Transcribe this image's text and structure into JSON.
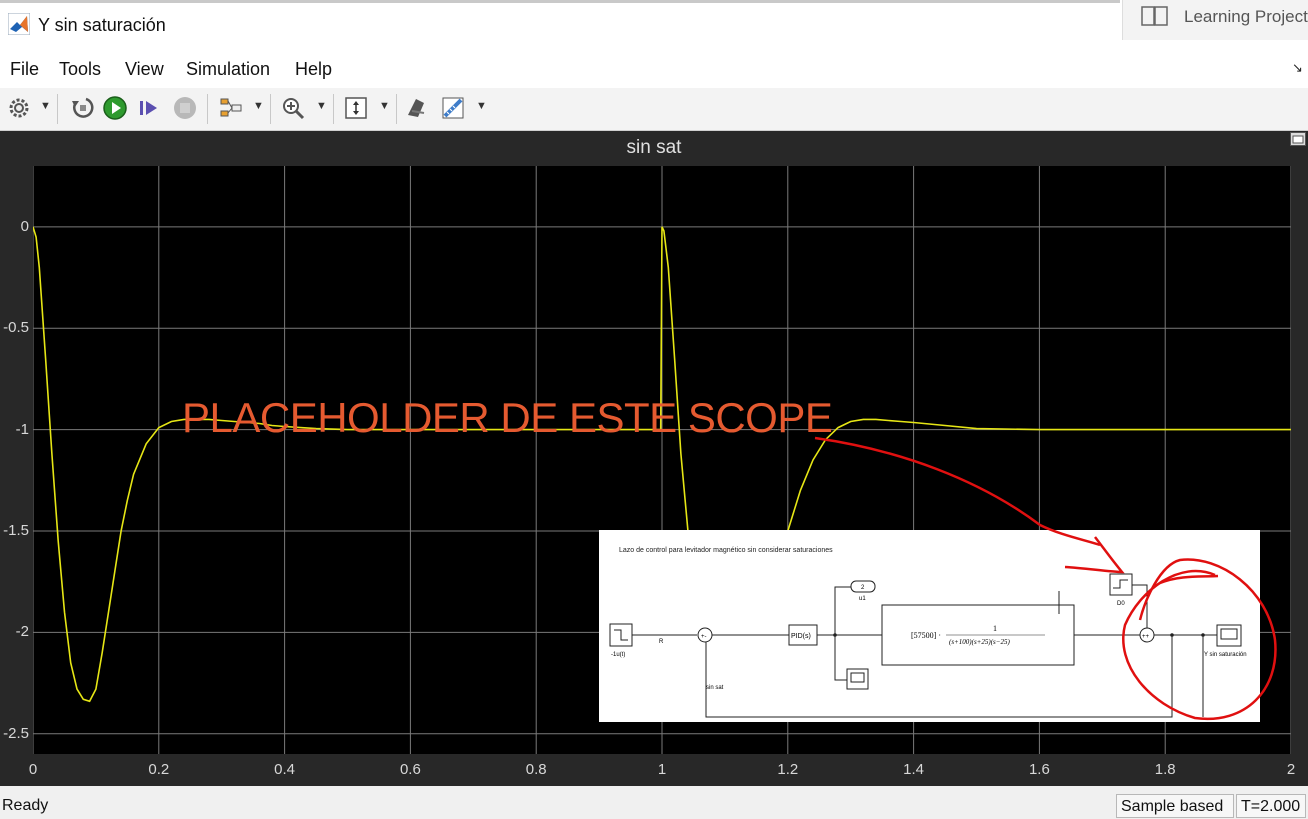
{
  "window": {
    "title": "Y sin saturación",
    "app_icon": "matlab-logo-icon"
  },
  "learning_tab": {
    "label": "Learning Project",
    "icon": "book-icon"
  },
  "menu": [
    "File",
    "Tools",
    "View",
    "Simulation",
    "Help"
  ],
  "toolbar": {
    "icons": [
      "settings-gear-icon",
      "step-back-icon",
      "run-icon",
      "step-forward-icon",
      "stop-icon",
      "signal-selector-icon",
      "zoom-in-icon",
      "scale-axes-icon",
      "highlight-simulink-block-icon",
      "measurement-icon"
    ]
  },
  "colors": {
    "trace": "#e6e615",
    "axes_bg": "#000000",
    "frame_bg": "#282828",
    "grid": "#7a7a7a",
    "annotation": "#e55a30",
    "ink": "#e01010"
  },
  "chart_data": {
    "type": "line",
    "title": "sin sat",
    "xlabel": "",
    "ylabel": "",
    "xlim": [
      0,
      2
    ],
    "ylim": [
      -2.6,
      0.3
    ],
    "xticks": [
      0,
      0.2,
      0.4,
      0.6,
      0.8,
      1,
      1.2,
      1.4,
      1.6,
      1.8,
      2
    ],
    "yticks": [
      0,
      -0.5,
      -1,
      -1.5,
      -2,
      -2.5
    ],
    "xtick_labels": [
      "0",
      "0.2",
      "0.4",
      "0.6",
      "0.8",
      "1",
      "1.2",
      "1.4",
      "1.6",
      "1.8",
      "2"
    ],
    "ytick_labels": [
      "0",
      "-0.5",
      "-1",
      "-1.5",
      "-2",
      "-2.5"
    ],
    "grid": true,
    "series": [
      {
        "x": [
          0,
          0.005,
          0.01,
          0.02,
          0.03,
          0.04,
          0.05,
          0.06,
          0.07,
          0.08,
          0.09,
          0.1,
          0.11,
          0.12,
          0.13,
          0.14,
          0.15,
          0.16,
          0.18,
          0.2,
          0.22,
          0.24,
          0.26,
          0.28,
          0.3,
          0.32,
          0.34,
          0.36,
          0.38,
          0.4,
          0.45,
          0.5,
          0.6,
          0.7,
          0.8,
          0.9,
          0.998,
          1.0,
          1.003,
          1.01,
          1.02,
          1.03,
          1.05,
          1.07,
          1.09,
          1.11,
          1.13,
          1.15,
          1.17,
          1.19,
          1.2,
          1.22,
          1.24,
          1.26,
          1.28,
          1.3,
          1.32,
          1.34,
          1.36,
          1.38,
          1.4,
          1.45,
          1.5,
          1.6,
          1.7,
          1.8,
          1.9,
          2.0
        ],
        "y": [
          0,
          -0.05,
          -0.2,
          -0.65,
          -1.12,
          -1.55,
          -1.9,
          -2.15,
          -2.28,
          -2.33,
          -2.34,
          -2.28,
          -2.1,
          -1.9,
          -1.7,
          -1.5,
          -1.35,
          -1.22,
          -1.07,
          -0.99,
          -0.96,
          -0.95,
          -0.95,
          -0.95,
          -0.955,
          -0.96,
          -0.965,
          -0.97,
          -0.98,
          -0.985,
          -0.995,
          -1.0,
          -1.0,
          -1.0,
          -1.0,
          -1.0,
          -1.0,
          0,
          -0.02,
          -0.2,
          -0.65,
          -1.12,
          -1.8,
          -2.2,
          -2.33,
          -2.34,
          -2.28,
          -2.1,
          -1.9,
          -1.6,
          -1.5,
          -1.3,
          -1.15,
          -1.05,
          -0.99,
          -0.96,
          -0.95,
          -0.95,
          -0.955,
          -0.96,
          -0.965,
          -0.98,
          -0.995,
          -1.0,
          -1.0,
          -1.0,
          -1.0,
          -1.0
        ]
      }
    ]
  },
  "annotation": {
    "placeholder_text": "PLACEHOLDER DE ESTE SCOPE"
  },
  "inset": {
    "title": "Lazo de control para levitador magnético sin considerar saturaciones",
    "step_label": "-1u(t)",
    "r_label": "R",
    "sum_sign": "+-",
    "pid_label": "PID(s)",
    "outport_num": "2",
    "outport_label": "u1",
    "plant_gain": "[57500] ·",
    "plant_num": "1",
    "plant_den": "(s+100)(s+25)(s−25)",
    "d0_label": "D0",
    "sum2_sign": "++",
    "scope_label": "Y sin saturación",
    "feedback_label": "sin sat"
  },
  "status": {
    "ready": "Ready",
    "sample": "Sample based",
    "time": "T=2.000"
  }
}
